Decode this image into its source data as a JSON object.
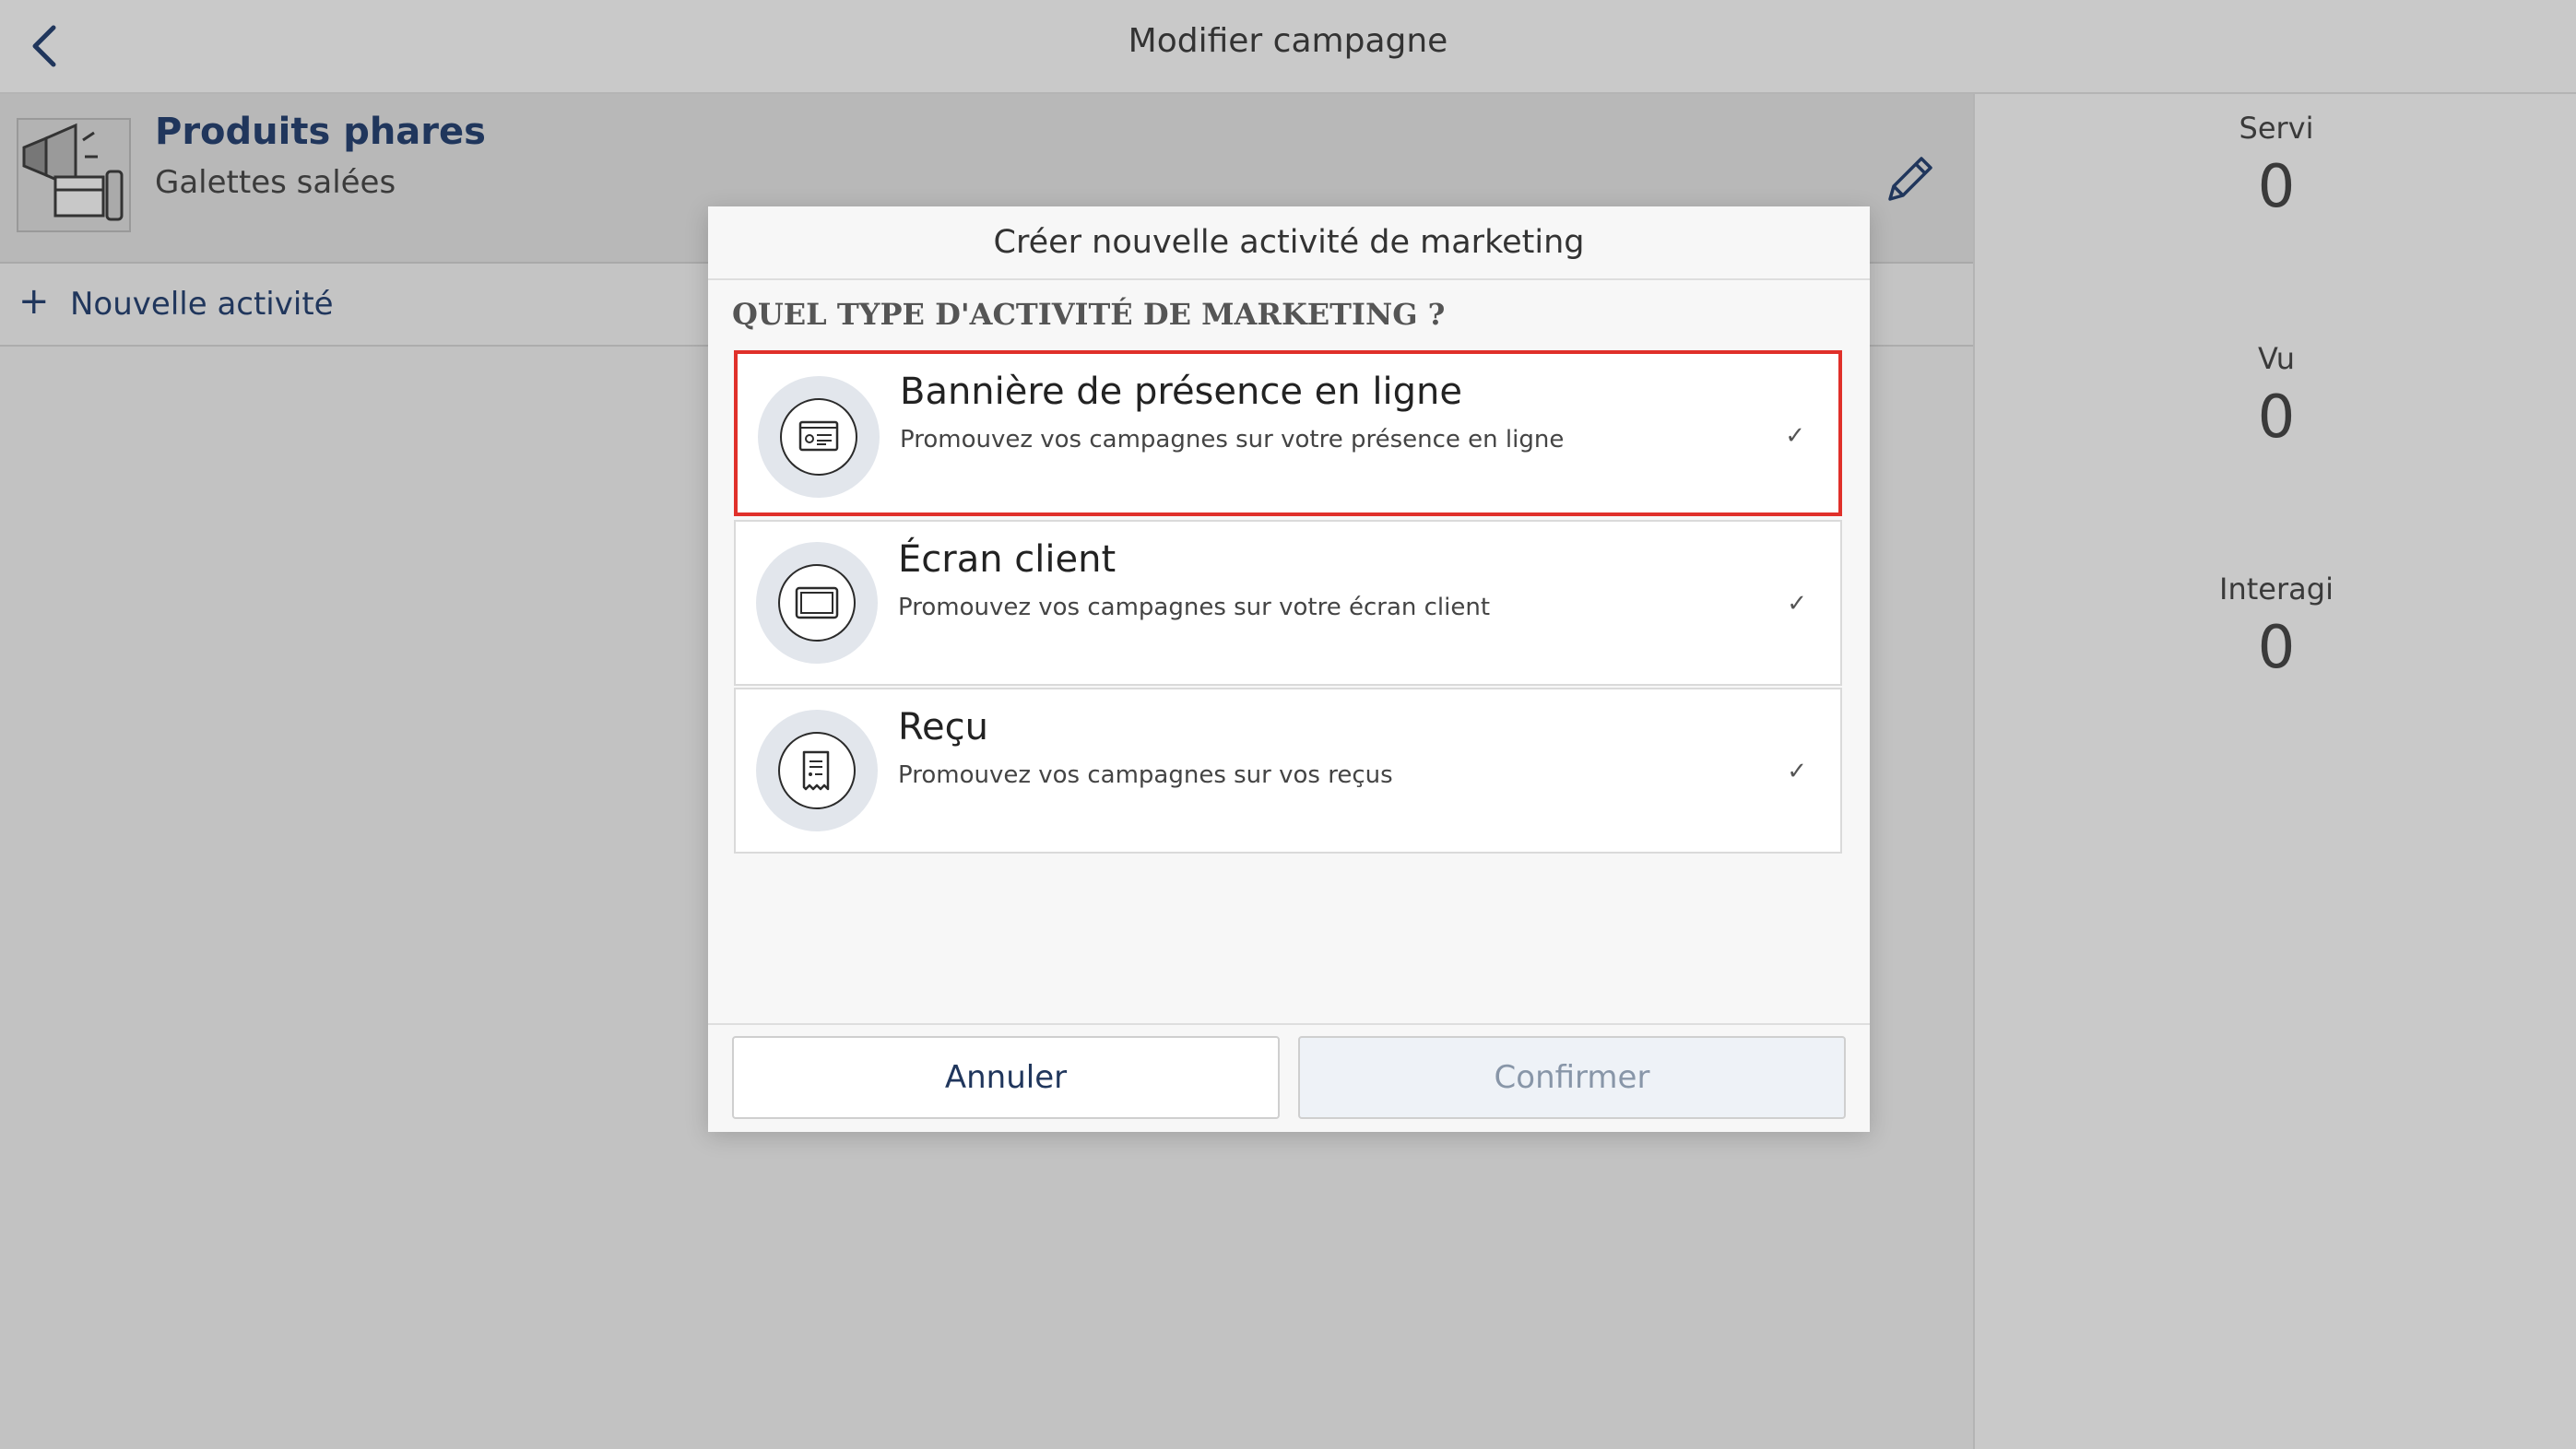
{
  "header": {
    "title": "Modifier campagne"
  },
  "campaign": {
    "name": "Produits phares",
    "subtitle": "Galettes salées"
  },
  "new_activity": {
    "plus": "+",
    "label": "Nouvelle activité"
  },
  "stats": [
    {
      "label": "Servi",
      "value": "0"
    },
    {
      "label": "Vu",
      "value": "0"
    },
    {
      "label": "Interagi",
      "value": "0"
    }
  ],
  "dialog": {
    "title": "Créer nouvelle activité de marketing",
    "question": "QUEL TYPE D'ACTIVITÉ DE MARKETING ?",
    "options": [
      {
        "title": "Bannière de présence en ligne",
        "description": "Promouvez vos campagnes sur votre présence en ligne",
        "icon": "web-banner-icon",
        "check": "✓",
        "selected": true
      },
      {
        "title": "Écran client",
        "description": "Promouvez vos campagnes sur votre écran client",
        "icon": "screen-icon",
        "check": "✓",
        "selected": false
      },
      {
        "title": "Reçu",
        "description": "Promouvez vos campagnes sur vos reçus",
        "icon": "receipt-icon",
        "check": "✓",
        "selected": false
      }
    ],
    "cancel_label": "Annuler",
    "confirm_label": "Confirmer"
  },
  "colors": {
    "accent": "#20365c",
    "selection_border": "#e0302a"
  }
}
